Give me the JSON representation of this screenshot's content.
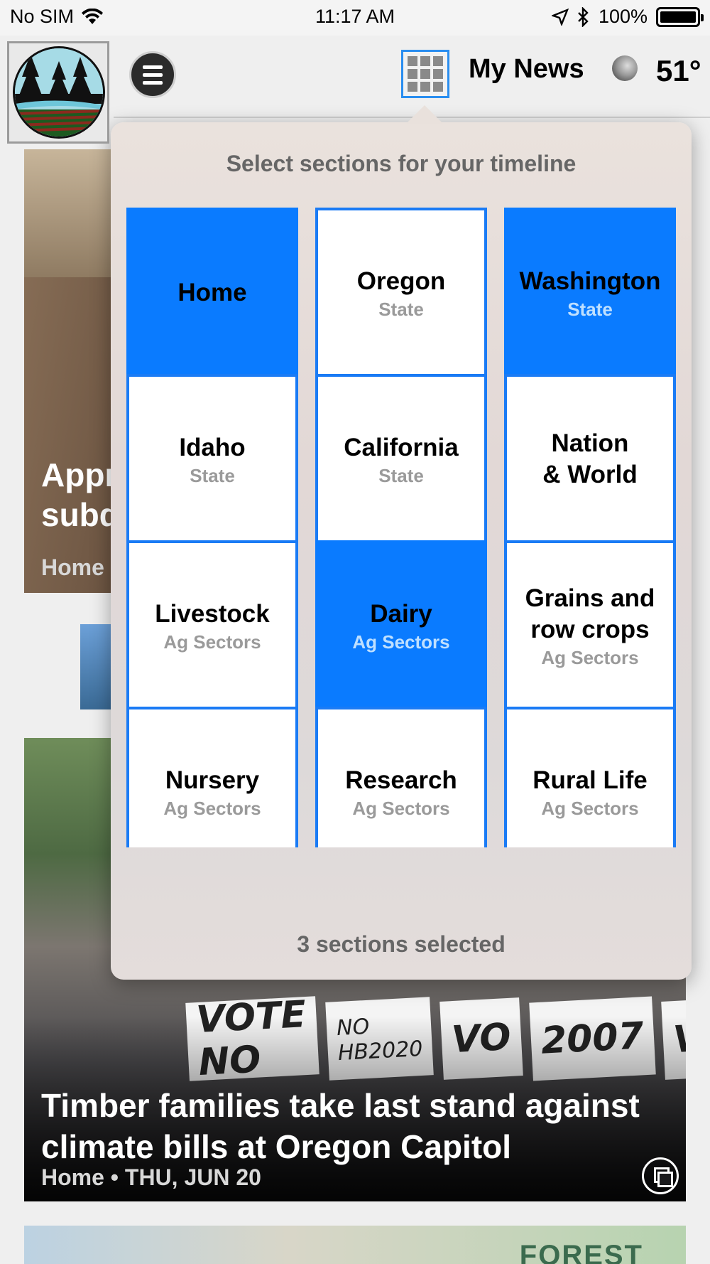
{
  "status_bar": {
    "carrier": "No SIM",
    "time": "11:17 AM",
    "battery": "100%"
  },
  "header": {
    "title": "My News",
    "temperature": "51°",
    "icons": [
      "logo",
      "menu-icon",
      "grid-icon",
      "moon-icon"
    ]
  },
  "popover": {
    "title": "Select sections for your timeline",
    "footer": "3 sections selected",
    "tiles": [
      {
        "name": "Home",
        "sub": "",
        "selected": true
      },
      {
        "name": "Oregon",
        "sub": "State",
        "selected": false
      },
      {
        "name": "Washington",
        "sub": "State",
        "selected": true
      },
      {
        "name": "Idaho",
        "sub": "State",
        "selected": false
      },
      {
        "name": "California",
        "sub": "State",
        "selected": false
      },
      {
        "name": "Nation\n& World",
        "sub": "",
        "selected": false
      },
      {
        "name": "Livestock",
        "sub": "Ag Sectors",
        "selected": false
      },
      {
        "name": "Dairy",
        "sub": "Ag Sectors",
        "selected": true
      },
      {
        "name": "Grains and\nrow crops",
        "sub": "Ag Sectors",
        "selected": false
      },
      {
        "name": "Nursery",
        "sub": "Ag Sectors",
        "selected": false
      },
      {
        "name": "Research",
        "sub": "Ag Sectors",
        "selected": false
      },
      {
        "name": "Rural Life",
        "sub": "Ag Sectors",
        "selected": false
      }
    ]
  },
  "feed": {
    "card1": {
      "title_line1": "Appr",
      "title_line2": "subd",
      "meta": "Home"
    },
    "card2": {
      "title": "Timber families take last stand against climate bills at Oregon Capitol",
      "meta": "Home • THU, JUN 20",
      "signs": [
        "VOTE NO",
        "NO HB2020",
        "VO",
        "2007",
        "VO"
      ]
    },
    "card3": {
      "label": "FOREST"
    }
  },
  "colors": {
    "accent": "#0a7bff",
    "tile_border": "#1a7bf5"
  }
}
